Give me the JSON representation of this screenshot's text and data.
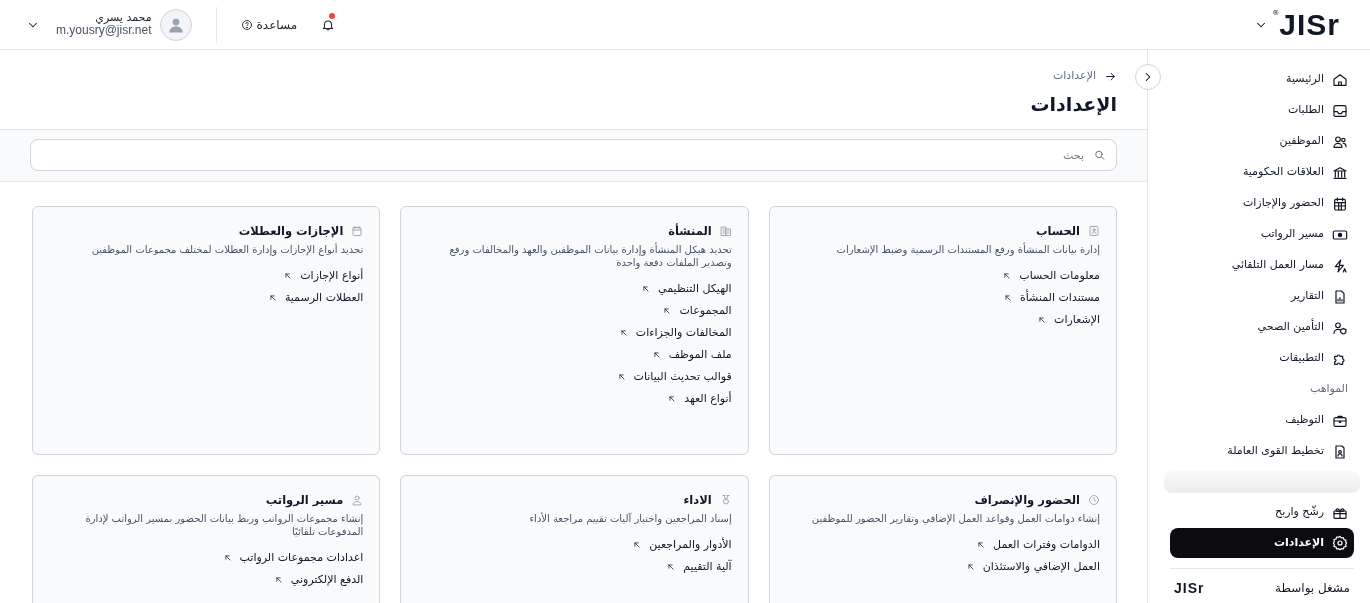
{
  "header": {
    "logo": "JISr",
    "logo_mark": "®",
    "notifications": {
      "unread": true
    },
    "help": "مساعدة",
    "user": {
      "name": "محمد يسري",
      "email": "m.yousry@jisr.net"
    }
  },
  "sidebar": {
    "items": [
      {
        "kind": "item",
        "label": "الرئيسية",
        "selected": false
      },
      {
        "kind": "item",
        "label": "الطلبات",
        "selected": false
      },
      {
        "kind": "item",
        "label": "الموظفين",
        "selected": false
      },
      {
        "kind": "item",
        "label": "العلاقات الحكومية",
        "selected": false
      },
      {
        "kind": "item",
        "label": "الحضور والإجازات",
        "selected": false
      },
      {
        "kind": "item",
        "label": "مسير الرواتب",
        "selected": false
      },
      {
        "kind": "item",
        "label": "مسار العمل التلقائي",
        "selected": false
      },
      {
        "kind": "item",
        "label": "التقارير",
        "selected": false
      },
      {
        "kind": "item",
        "label": "التأمين الصحي",
        "selected": false
      },
      {
        "kind": "item",
        "label": "التطبيقات",
        "selected": false
      },
      {
        "kind": "section",
        "label": "المواهب"
      },
      {
        "kind": "item",
        "label": "التوظيف",
        "selected": false
      },
      {
        "kind": "item",
        "label": "تخطيط القوى العاملة",
        "selected": false
      },
      {
        "kind": "loading"
      },
      {
        "kind": "item",
        "label": "رشّح واربح",
        "selected": false
      },
      {
        "kind": "item",
        "label": "الإعدادات",
        "selected": true
      }
    ],
    "footer": {
      "label": "مشغل بواسطة",
      "logo": "JISr"
    }
  },
  "breadcrumb": "الإعدادات",
  "title": "الإعدادات",
  "search": {
    "placeholder": "بحث"
  },
  "cards": [
    {
      "title": "الحساب",
      "description": "إدارة بيانات المنشأة ورفع المستندات الرسمية وضبط الإشعارات",
      "links": [
        "معلومات الحساب",
        "مستندات المنشأة",
        "الإشعارات"
      ]
    },
    {
      "title": "المنشأة",
      "description": "تحديد هيكل المنشأة وإدارة بيانات الموظفين والعهد والمخالفات ورفع وتصدير الملفات دفعة واحدة",
      "links": [
        "الهيكل التنظيمي",
        "المجموعات",
        "المخالفات والجزاءات",
        "ملف الموظف",
        "قوالب تحديث البيانات",
        "أنواع العهد"
      ]
    },
    {
      "title": "الإجازات والعطلات",
      "description": "تحديد أنواع الإجازات وإدارة العطلات لمختلف مجموعات الموظفين",
      "links": [
        "أنواع الإجازات",
        "العطلات الرسمية"
      ]
    },
    {
      "title": "الحضور والإنصراف",
      "description": "إنشاء دوامات العمل وقواعد العمل الإضافي وتقارير الحضور للموظفين",
      "links": [
        "الدوامات وفترات العمل",
        "العمل الإضافي والاستئذان"
      ]
    },
    {
      "title": "الاداء",
      "description": "إسناد المراجعين واختيار آليات تقييم مراجعة الأداء",
      "links": [
        "الأدوار والمراجعين",
        "آلية التقييم"
      ]
    },
    {
      "title": "مسير الرواتب",
      "description": "إنشاء مجموعات الرواتب وربط بيانات الحضور بمسير الرواتب لإدارة المدفوعات تلقائيًا",
      "links": [
        "اعدادات مجموعات الرواتب",
        "الدفع الإلكتروني"
      ]
    }
  ]
}
